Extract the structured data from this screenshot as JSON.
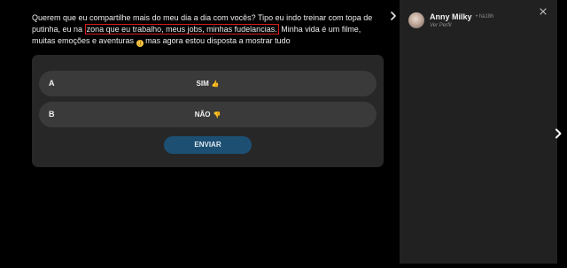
{
  "caption": {
    "before": "Querem que eu compartilhe mais do meu dia a dia com vocês? Tipo eu indo treinar com topa de putinha, eu na ",
    "highlight": "zona que eu trabalho, meus jobs, minhas fudelancias.",
    "after": " Minha vida é um filme, muitas emoções e aventuras ",
    "emoji": "😉",
    "end": " mas agora estou disposta a mostrar tudo"
  },
  "poll": {
    "options": [
      {
        "letter": "A",
        "label": "SIM",
        "emoji": "👍"
      },
      {
        "letter": "B",
        "label": "NÃO",
        "emoji": "👎"
      }
    ],
    "submit_label": "ENVIAR"
  },
  "profile": {
    "name": "Anny Milky",
    "time": "• há18h",
    "link": "Ver Perfil"
  },
  "colors": {
    "highlight_border": "#d81e1e",
    "submit_bg": "#1d4f73",
    "card_bg": "#272727",
    "option_bg": "#3a3a3a",
    "panel_bg": "#212121"
  },
  "icons": {
    "panel_toggle": "chevron-right-icon",
    "close": "close-icon",
    "next": "chevron-right-icon"
  }
}
